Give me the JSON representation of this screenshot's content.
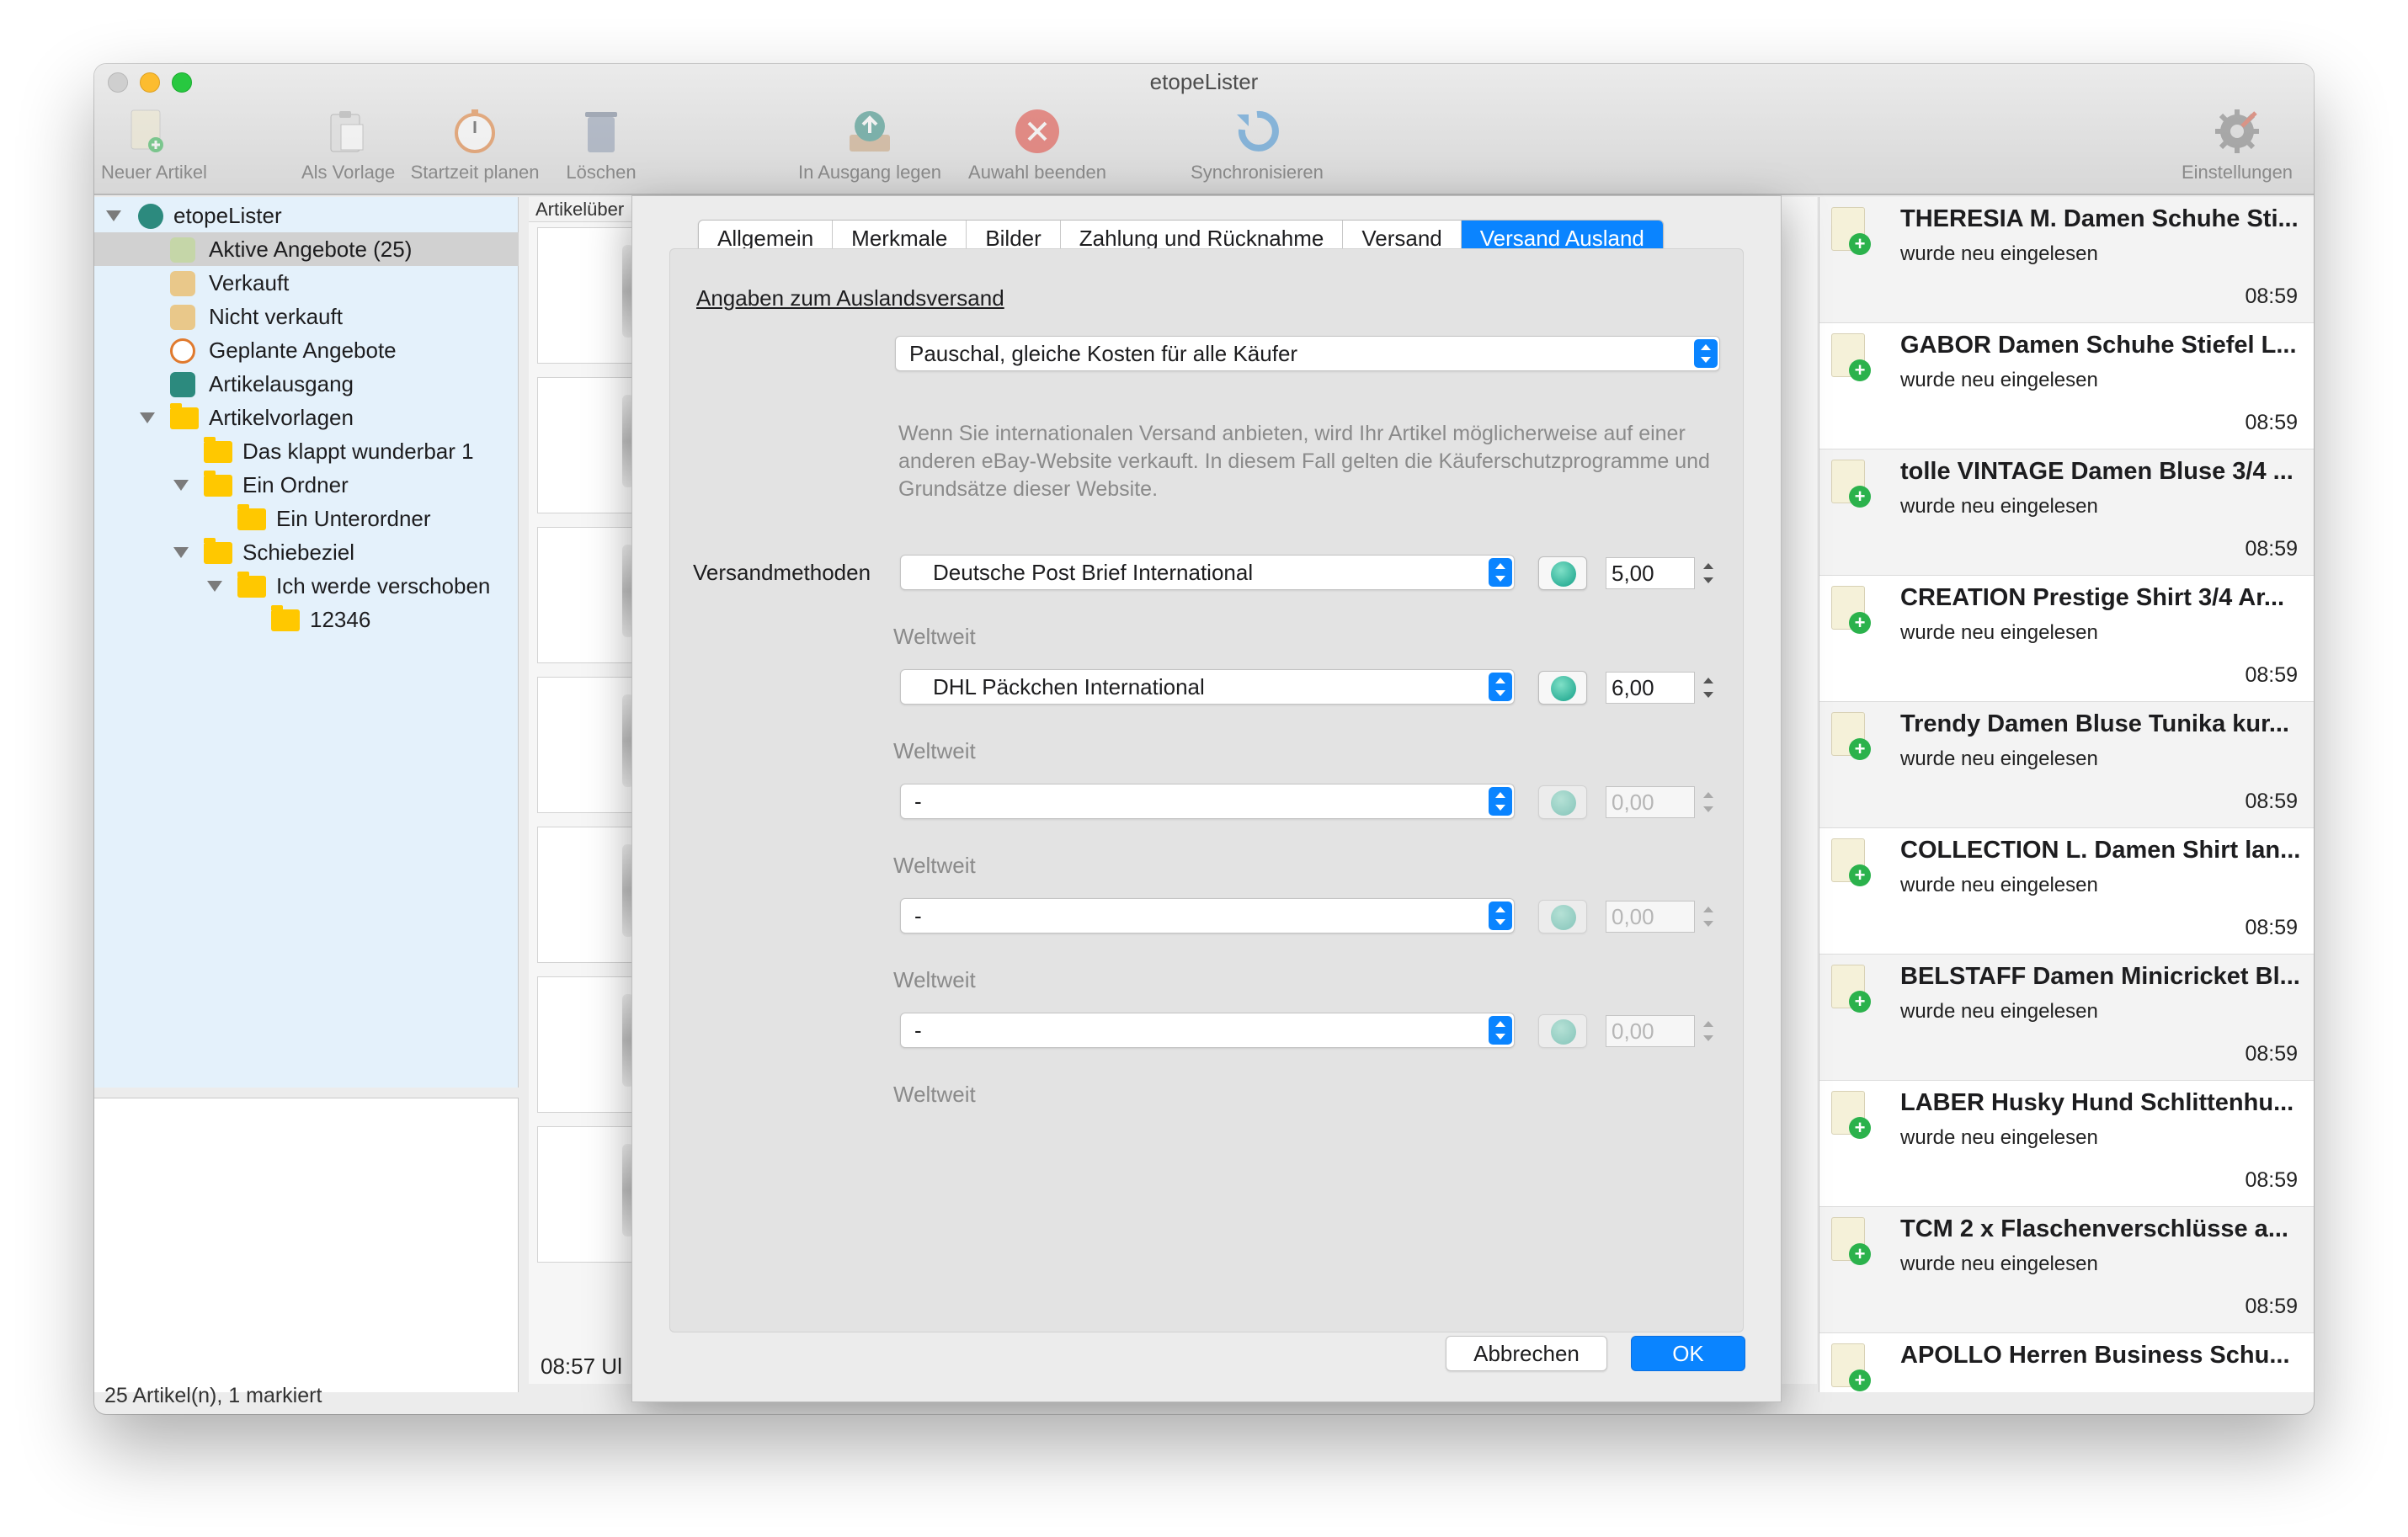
{
  "window": {
    "title": "etopeLister"
  },
  "toolbar": {
    "new_article": "Neuer Artikel",
    "as_template": "Als Vorlage",
    "plan_start": "Startzeit planen",
    "delete": "Löschen",
    "to_outbox": "In Ausgang legen",
    "end_selection": "Auwahl beenden",
    "sync": "Synchronisieren",
    "settings": "Einstellungen"
  },
  "sidebar": {
    "root": "etopeLister",
    "items": [
      {
        "label": "Aktive Angebote (25)"
      },
      {
        "label": "Verkauft"
      },
      {
        "label": "Nicht verkauft"
      },
      {
        "label": "Geplante Angebote"
      },
      {
        "label": "Artikelausgang"
      }
    ],
    "templates": "Artikelvorlagen",
    "folders": [
      {
        "label": "Das klappt wunderbar 1"
      },
      {
        "label": "Ein Ordner"
      },
      {
        "label": "Ein Unterordner"
      },
      {
        "label": "Schiebeziel"
      },
      {
        "label": "Ich werde verschoben"
      },
      {
        "label": "12346"
      }
    ]
  },
  "middle": {
    "header": "Artikelüber",
    "time": "08:57 Ul"
  },
  "status": {
    "text": "25 Artikel(n), 1 markiert"
  },
  "feed": {
    "items": [
      {
        "title": "THERESIA M. Damen Schuhe Sti...",
        "subtitle": "wurde neu eingelesen",
        "time": "08:59"
      },
      {
        "title": "GABOR Damen Schuhe Stiefel L...",
        "subtitle": "wurde neu eingelesen",
        "time": "08:59"
      },
      {
        "title": "tolle VINTAGE Damen Bluse 3/4 ...",
        "subtitle": "wurde neu eingelesen",
        "time": "08:59"
      },
      {
        "title": "CREATION Prestige Shirt 3/4 Ar...",
        "subtitle": "wurde neu eingelesen",
        "time": "08:59"
      },
      {
        "title": "Trendy Damen Bluse Tunika kur...",
        "subtitle": "wurde neu eingelesen",
        "time": "08:59"
      },
      {
        "title": "COLLECTION L. Damen Shirt lan...",
        "subtitle": "wurde neu eingelesen",
        "time": "08:59"
      },
      {
        "title": "BELSTAFF Damen Minicricket Bl...",
        "subtitle": "wurde neu eingelesen",
        "time": "08:59"
      },
      {
        "title": "LABER Husky Hund Schlittenhu...",
        "subtitle": "wurde neu eingelesen",
        "time": "08:59"
      },
      {
        "title": "TCM 2 x Flaschenverschlüsse a...",
        "subtitle": "wurde neu eingelesen",
        "time": "08:59"
      },
      {
        "title": "APOLLO Herren Business Schu...",
        "subtitle": "",
        "time": ""
      }
    ]
  },
  "dialog": {
    "tabs": [
      "Allgemein",
      "Merkmale",
      "Bilder",
      "Zahlung und Rücknahme",
      "Versand",
      "Versand Ausland"
    ],
    "active_tab": "Versand Ausland",
    "section_title": "Angaben zum Auslandsversand",
    "cost_mode": "Pauschal, gleiche Kosten für alle Käufer",
    "info_text": "Wenn Sie internationalen Versand anbieten, wird Ihr Artikel möglicherweise auf einer anderen eBay-Website verkauft. In diesem Fall gelten die Käuferschutzprogramme und Grundsätze dieser Website.",
    "methods_label": "Versandmethoden",
    "methods": [
      {
        "service": "Deutsche Post Brief International",
        "price": "5,00",
        "region": "Weltweit",
        "enabled": true
      },
      {
        "service": "DHL Päckchen International",
        "price": "6,00",
        "region": "Weltweit",
        "enabled": true
      },
      {
        "service": "-",
        "price": "0,00",
        "region": "Weltweit",
        "enabled": false
      },
      {
        "service": "-",
        "price": "0,00",
        "region": "Weltweit",
        "enabled": false
      },
      {
        "service": "-",
        "price": "0,00",
        "region": "Weltweit",
        "enabled": false
      }
    ],
    "cancel": "Abbrechen",
    "ok": "OK"
  },
  "colors": {
    "accent": "#0a84ff",
    "sidebar_bg": "#e4f1fb",
    "add_badge": "#2bb24c"
  }
}
